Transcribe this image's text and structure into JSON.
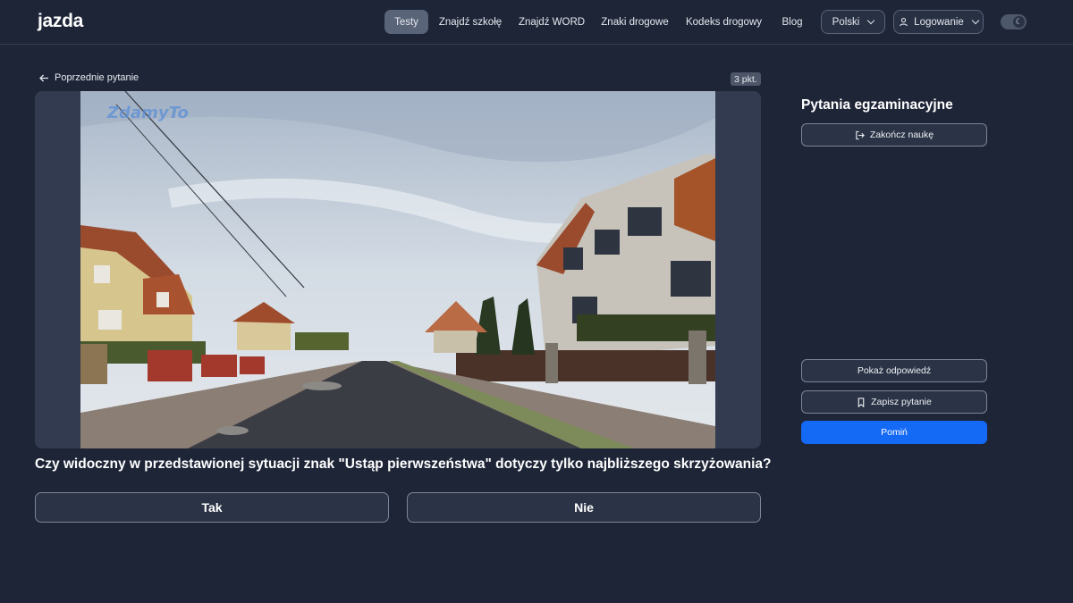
{
  "header": {
    "logo": "jazda",
    "nav": [
      "Testy",
      "Znajdź szkołę",
      "Znajdź WORD",
      "Znaki drogowe",
      "Kodeks drogowy",
      "Blog"
    ],
    "language": "Polski",
    "login": "Logowanie"
  },
  "question": {
    "prev_label": "Poprzednie pytanie",
    "points": "3 pkt.",
    "watermark": "ZdamyTo",
    "text": "Czy widoczny w przedstawionej sytuacji znak \"Ustąp pierwszeństwa\" dotyczy tylko najbliższego skrzyżowania?",
    "answers": [
      "Tak",
      "Nie"
    ]
  },
  "sidebar": {
    "title": "Pytania egzaminacyjne",
    "finish": "Zakończ naukę",
    "show_answer": "Pokaż odpowiedź",
    "save": "Zapisz pytanie",
    "skip": "Pomiń"
  },
  "colors": {
    "background": "#1d2537",
    "primary": "#1469f5",
    "active_nav": "#5a6478"
  }
}
